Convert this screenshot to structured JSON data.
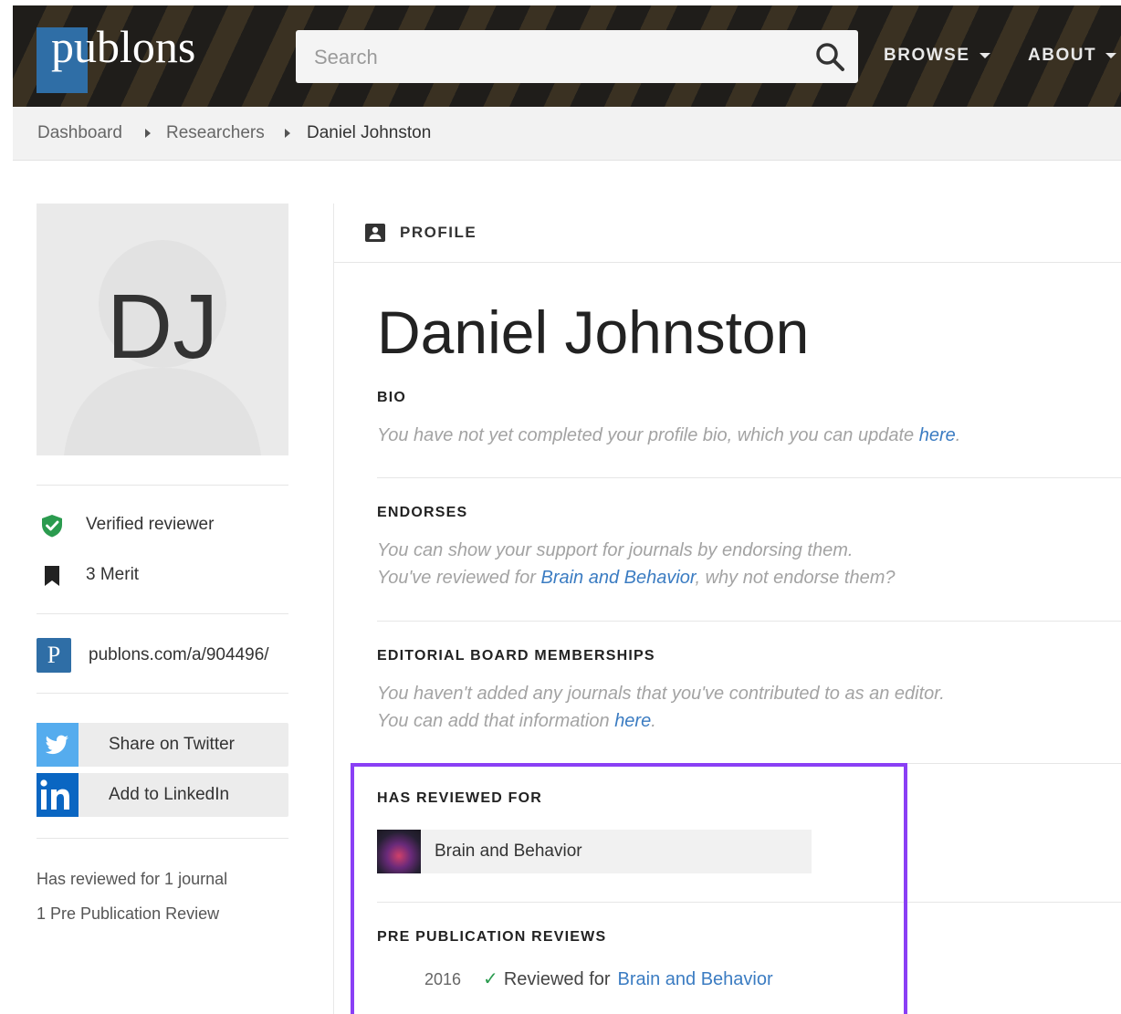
{
  "header": {
    "logo": "publons",
    "search_placeholder": "Search",
    "nav": [
      {
        "label": "BROWSE"
      },
      {
        "label": "ABOUT"
      }
    ]
  },
  "breadcrumb": [
    "Dashboard",
    "Researchers",
    "Daniel Johnston"
  ],
  "sidebar": {
    "initials": "DJ",
    "verified": "Verified reviewer",
    "merit": "3 Merit",
    "url_badge": "P",
    "url": "publons.com/a/904496/",
    "twitter": "Share on Twitter",
    "linkedin": "Add to LinkedIn",
    "summary": [
      "Has reviewed for 1 journal",
      "1 Pre Publication Review"
    ]
  },
  "main": {
    "section_label": "PROFILE",
    "name": "Daniel Johnston",
    "bio": {
      "title": "BIO",
      "text": "You have not yet completed your profile bio, which you can update ",
      "link": "here",
      "end": "."
    },
    "endorses": {
      "title": "ENDORSES",
      "line1": "You can show your support for journals by endorsing them.",
      "line2_pre": "You've reviewed for ",
      "line2_link": "Brain and Behavior",
      "line2_post": ", why not endorse them?"
    },
    "editorial": {
      "title": "EDITORIAL BOARD MEMBERSHIPS",
      "line1": "You haven't added any journals that you've contributed to as an editor.",
      "line2_pre": "You can add that information ",
      "line2_link": "here",
      "line2_post": "."
    },
    "reviewed_for": {
      "title": "HAS REVIEWED FOR",
      "journal": "Brain and Behavior"
    },
    "pre_pub": {
      "title": "PRE PUBLICATION REVIEWS",
      "year": "2016",
      "check": "✓",
      "label": "Reviewed for",
      "journal": "Brain and Behavior"
    }
  },
  "colors": {
    "brand_blue": "#2f6ea6",
    "link": "#3b7cc2",
    "highlight": "#8a3ff5",
    "verified_green": "#2b9b4f",
    "twitter": "#55acee",
    "linkedin": "#0a66c2"
  }
}
